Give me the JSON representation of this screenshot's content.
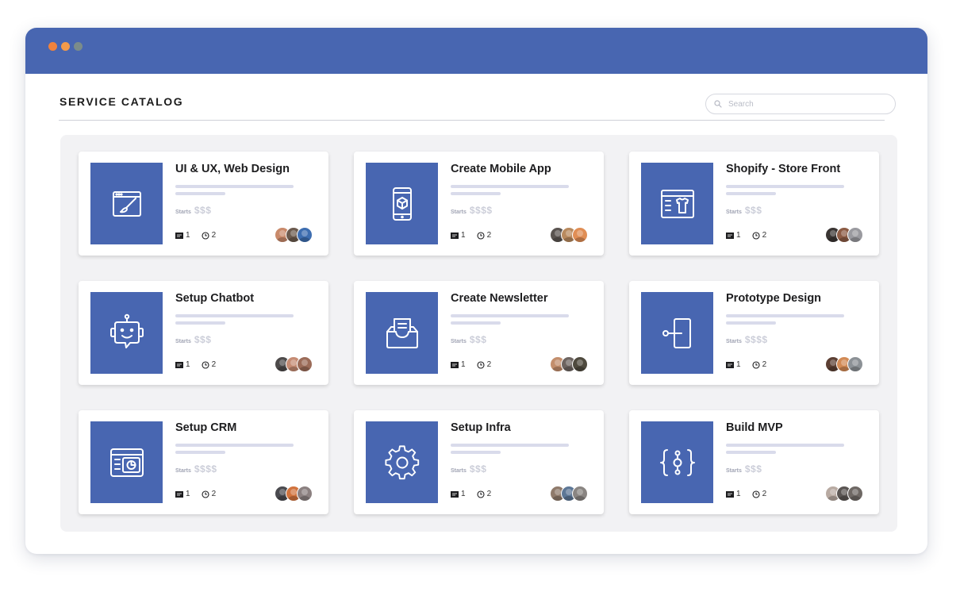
{
  "page": {
    "title": "SERVICE CATALOG",
    "search_placeholder": "Search"
  },
  "colors": {
    "accent": "#4866b1",
    "window_dots": [
      "#f0823c",
      "#f39a4a",
      "#7b8c8a"
    ]
  },
  "cards": [
    {
      "title": "UI & UX, Web Design",
      "icon": "web-design-icon",
      "starts_label": "Starts",
      "price": "$$$",
      "docs": "1",
      "time": "2",
      "avatars": [
        "#c98a6b",
        "#6b5a4e",
        "#3d6db0"
      ]
    },
    {
      "title": "Create Mobile App",
      "icon": "mobile-app-icon",
      "starts_label": "Starts",
      "price": "$$$$",
      "docs": "1",
      "time": "2",
      "avatars": [
        "#5a5450",
        "#b98a5e",
        "#e08e55"
      ]
    },
    {
      "title": "Shopify - Store Front",
      "icon": "store-front-icon",
      "starts_label": "Starts",
      "price": "$$$",
      "docs": "1",
      "time": "2",
      "avatars": [
        "#3a3533",
        "#8c5b44",
        "#9a9a9f"
      ]
    },
    {
      "title": "Setup Chatbot",
      "icon": "chatbot-icon",
      "starts_label": "Starts",
      "price": "$$$",
      "docs": "1",
      "time": "2",
      "avatars": [
        "#4d4a4a",
        "#c58b73",
        "#9b6b58"
      ]
    },
    {
      "title": "Create Newsletter",
      "icon": "newsletter-icon",
      "starts_label": "Starts",
      "price": "$$$",
      "docs": "1",
      "time": "2",
      "avatars": [
        "#c38e6c",
        "#6d6460",
        "#4f4a3e"
      ]
    },
    {
      "title": "Prototype Design",
      "icon": "prototype-icon",
      "starts_label": "Starts",
      "price": "$$$$",
      "docs": "1",
      "time": "2",
      "avatars": [
        "#5c3f33",
        "#d28a55",
        "#8c9196"
      ]
    },
    {
      "title": "Setup CRM",
      "icon": "crm-dashboard-icon",
      "starts_label": "Starts",
      "price": "$$$$",
      "docs": "1",
      "time": "2",
      "avatars": [
        "#4a4a4f",
        "#d1733d",
        "#8b8080"
      ]
    },
    {
      "title": "Setup Infra",
      "icon": "gear-icon",
      "starts_label": "Starts",
      "price": "$$$",
      "docs": "1",
      "time": "2",
      "avatars": [
        "#8f7a6b",
        "#5d7796",
        "#8a8582"
      ]
    },
    {
      "title": "Build MVP",
      "icon": "code-braces-icon",
      "starts_label": "Starts",
      "price": "$$$",
      "docs": "1",
      "time": "2",
      "avatars": [
        "#b8aaa2",
        "#5a5553",
        "#6e6864"
      ]
    }
  ]
}
